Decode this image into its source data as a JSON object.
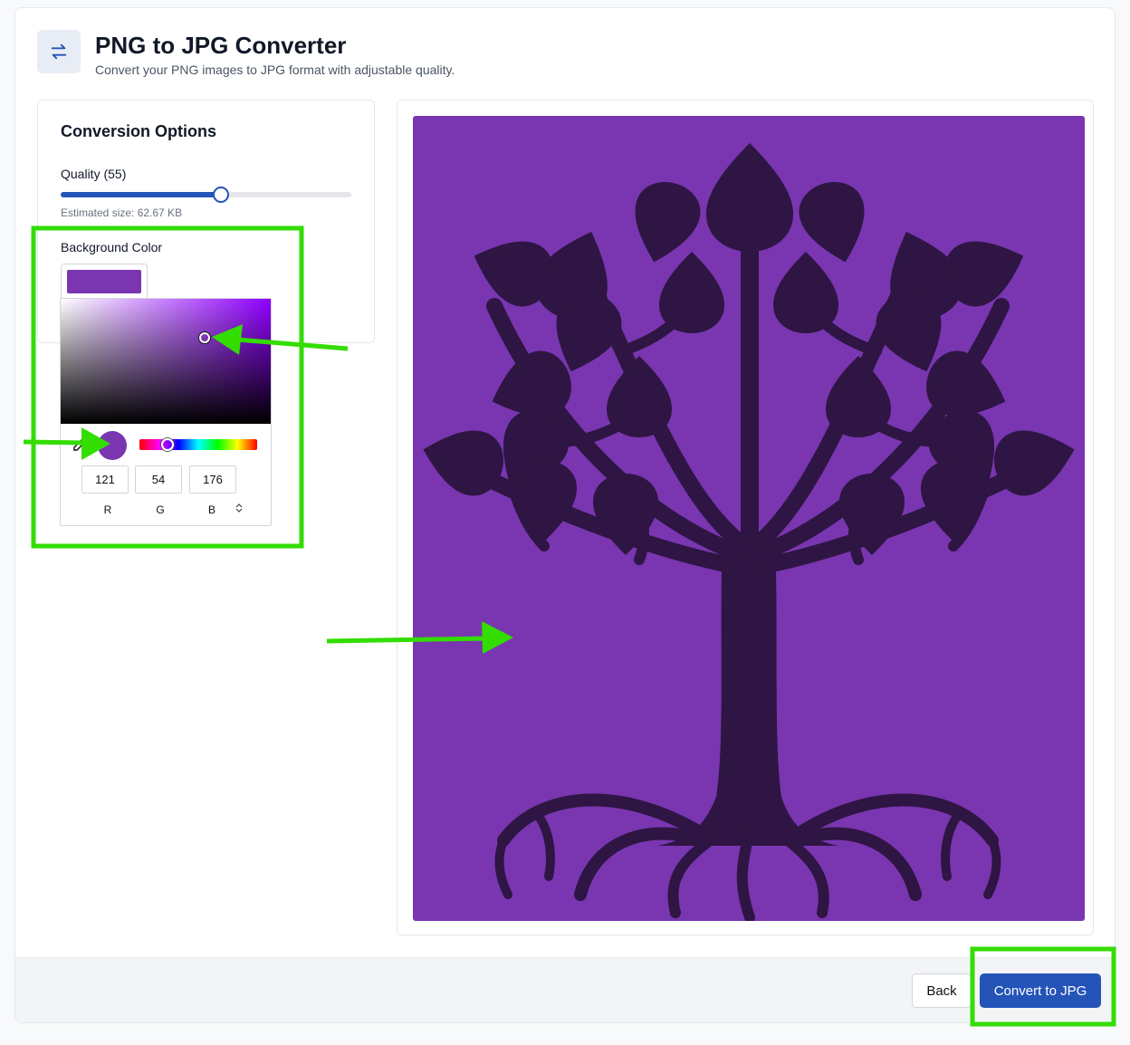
{
  "header": {
    "icon": "swap-arrows-icon",
    "title": "PNG to JPG Converter",
    "subtitle": "Convert your PNG images to JPG format with adjustable quality."
  },
  "options": {
    "heading": "Conversion Options",
    "quality_label": "Quality (55)",
    "quality_value": 55,
    "quality_max": 100,
    "estimated_size": "Estimated size: 62.67 KB",
    "background_label": "Background Color"
  },
  "color_picker": {
    "rgb": {
      "r": "121",
      "g": "54",
      "b": "176"
    },
    "labels": {
      "r": "R",
      "g": "G",
      "b": "B"
    },
    "hue_fraction": 0.24,
    "current_hex": "#7936b0",
    "hue_hex": "#9000ff",
    "toggle_icon": "chevron-up-down-icon",
    "eyedropper_icon": "eyedropper-icon"
  },
  "preview": {
    "background_hex": "#7936b0",
    "tree_hex": "#2e1543",
    "image": "tree-silhouette"
  },
  "footer": {
    "back_label": "Back",
    "convert_label": "Convert to JPG"
  },
  "colors": {
    "accent": "#2454b8",
    "annotation": "#33dd00"
  }
}
